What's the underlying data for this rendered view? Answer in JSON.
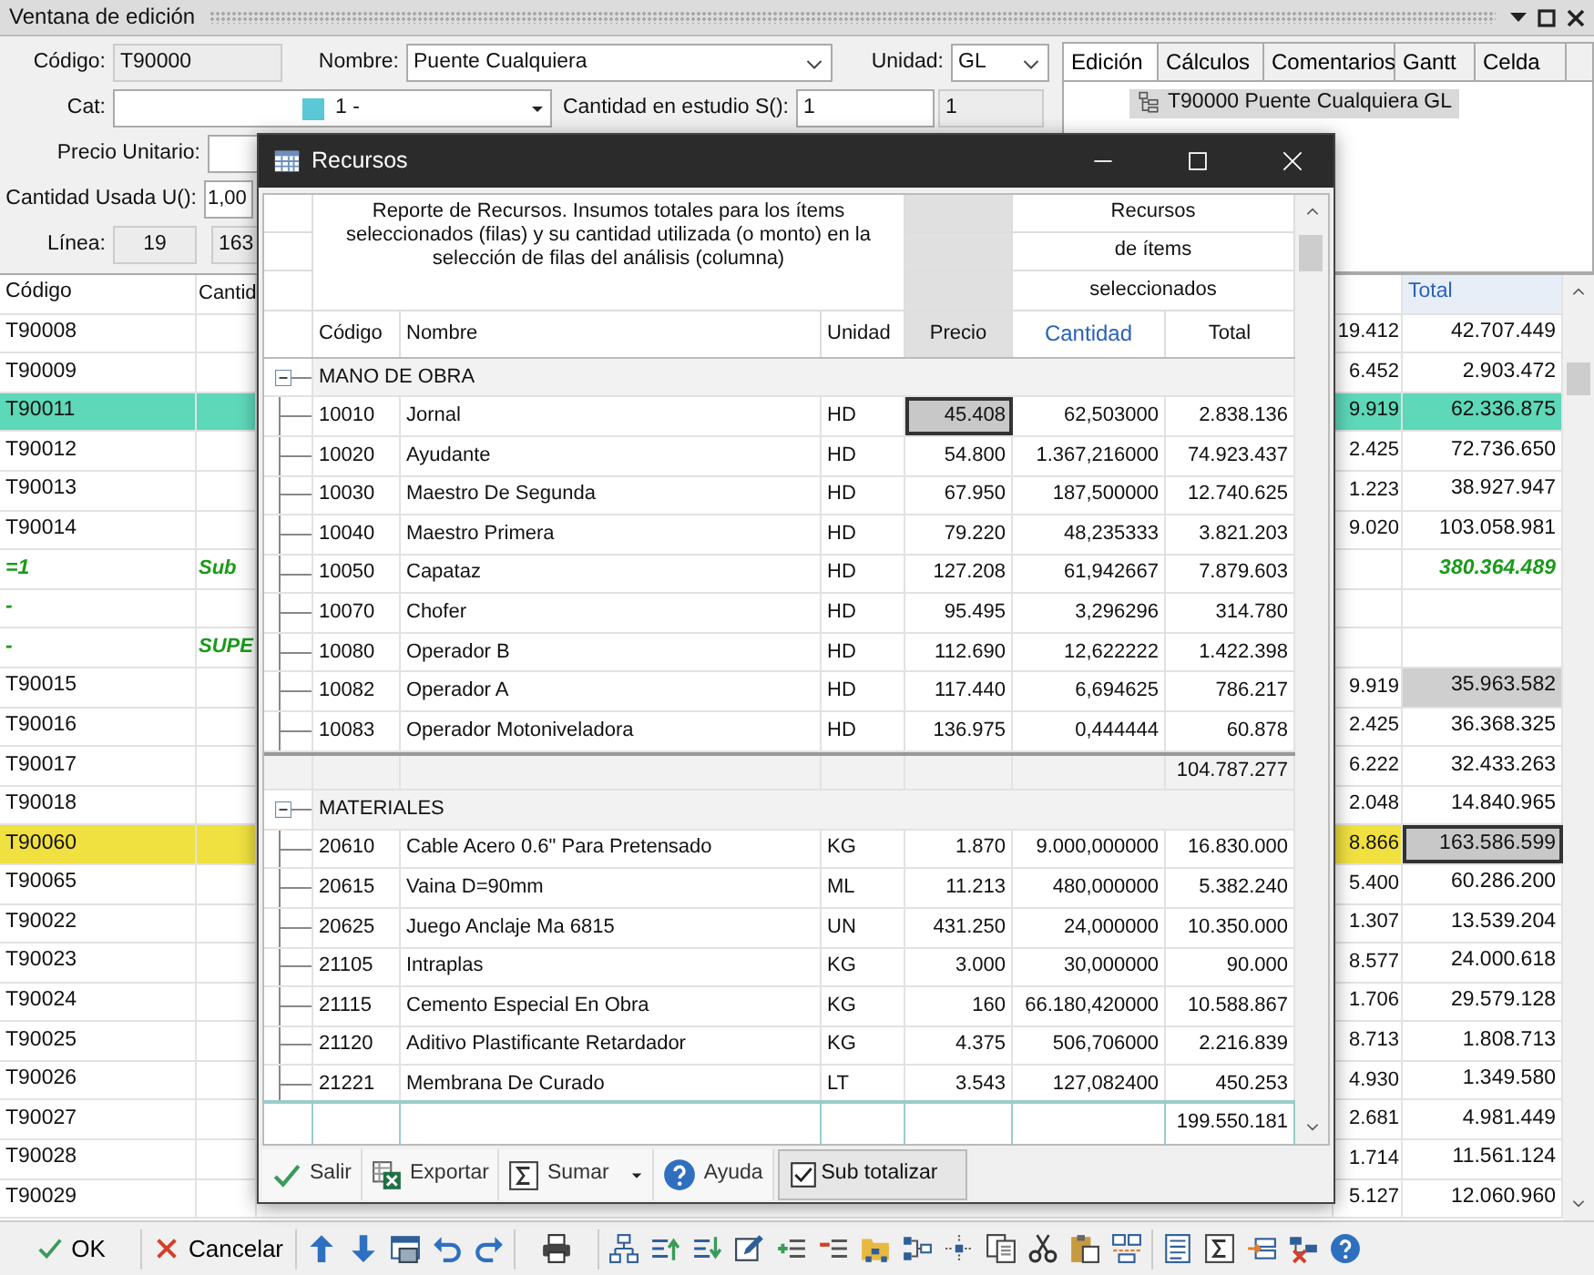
{
  "window": {
    "title": "Ventana de edición"
  },
  "form": {
    "codigo": {
      "label": "Código:",
      "value": "T90000"
    },
    "nombre": {
      "label": "Nombre:",
      "value": "Puente Cualquiera"
    },
    "unidad": {
      "label": "Unidad:",
      "value": "GL"
    },
    "cat": {
      "label": "Cat:",
      "value": "1 -",
      "color": "#5bc8d6"
    },
    "cantidad_estudio": {
      "label": "Cantidad en estudio S():",
      "value": "1",
      "value_2": "1"
    },
    "precio_unitario": {
      "label": "Precio Unitario:"
    },
    "cantidad_usada": {
      "label": "Cantidad Usada U():",
      "value": "1,00"
    },
    "linea": {
      "label": "Línea:",
      "value": "19",
      "value_2": "163"
    }
  },
  "side_panel": {
    "tabs": [
      {
        "label": "Edición",
        "selected": true
      },
      {
        "label": "Cálculos",
        "selected": false
      },
      {
        "label": "Comentarios",
        "selected": false
      },
      {
        "label": "Gantt",
        "selected": false
      },
      {
        "label": "Celda",
        "selected": false
      }
    ],
    "tree": [
      {
        "label": "T90000 Puente Cualquiera GL",
        "selected": true
      }
    ]
  },
  "table": {
    "columns": [
      "Código",
      "Cantid",
      "Total"
    ],
    "rows": [
      {
        "kind": "item",
        "code": "T90008",
        "column_2": "",
        "column_3": "19.412",
        "total": "42.707.449",
        "total_shaded": false,
        "total_focused": false
      },
      {
        "kind": "item",
        "code": "T90009",
        "column_2": "",
        "column_3": "6.452",
        "total": "2.903.472",
        "total_shaded": false,
        "total_focused": false
      },
      {
        "kind": "item",
        "code": "T90011",
        "column_2": "",
        "column_3": "9.919",
        "total": "62.336.875",
        "total_shaded": false,
        "total_focused": false,
        "color": "#5dd8b9"
      },
      {
        "kind": "item",
        "code": "T90012",
        "column_2": "",
        "column_3": "2.425",
        "total": "72.736.650",
        "total_shaded": false,
        "total_focused": false
      },
      {
        "kind": "item",
        "code": "T90013",
        "column_2": "",
        "column_3": "1.223",
        "total": "38.927.947",
        "total_shaded": false,
        "total_focused": false
      },
      {
        "kind": "item",
        "code": "T90014",
        "column_2": "",
        "column_3": "9.020",
        "total": "103.058.981",
        "total_shaded": false,
        "total_focused": false
      },
      {
        "kind": "subtotal",
        "code": "=1",
        "column_2": "Sub",
        "column_3": "",
        "total": "380.364.489",
        "total_shaded": false,
        "total_focused": false
      },
      {
        "kind": "subtotal",
        "code": "-",
        "column_2": "",
        "column_3": "",
        "total": "",
        "total_shaded": false,
        "total_focused": false
      },
      {
        "kind": "subtotal",
        "code": "-",
        "column_2": "SUPE",
        "column_3": "",
        "total": "",
        "total_shaded": false,
        "total_focused": false
      },
      {
        "kind": "item",
        "code": "T90015",
        "column_2": "",
        "column_3": "9.919",
        "total": "35.963.582",
        "total_shaded": true,
        "total_focused": false
      },
      {
        "kind": "item",
        "code": "T90016",
        "column_2": "",
        "column_3": "2.425",
        "total": "36.368.325",
        "total_shaded": false,
        "total_focused": false
      },
      {
        "kind": "item",
        "code": "T90017",
        "column_2": "",
        "column_3": "6.222",
        "total": "32.433.263",
        "total_shaded": false,
        "total_focused": false
      },
      {
        "kind": "item",
        "code": "T90018",
        "column_2": "",
        "column_3": "2.048",
        "total": "14.840.965",
        "total_shaded": false,
        "total_focused": false
      },
      {
        "kind": "item",
        "code": "T90060",
        "column_2": "",
        "column_3": "8.866",
        "total": "163.586.599",
        "total_shaded": false,
        "total_focused": true,
        "color": "#f0e040"
      },
      {
        "kind": "item",
        "code": "T90065",
        "column_2": "",
        "column_3": "5.400",
        "total": "60.286.200",
        "total_shaded": false,
        "total_focused": false
      },
      {
        "kind": "item",
        "code": "T90022",
        "column_2": "",
        "column_3": "1.307",
        "total": "13.539.204",
        "total_shaded": false,
        "total_focused": false
      },
      {
        "kind": "item",
        "code": "T90023",
        "column_2": "",
        "column_3": "8.577",
        "total": "24.000.618",
        "total_shaded": false,
        "total_focused": false
      },
      {
        "kind": "item",
        "code": "T90024",
        "column_2": "",
        "column_3": "1.706",
        "total": "29.579.128",
        "total_shaded": false,
        "total_focused": false
      },
      {
        "kind": "item",
        "code": "T90025",
        "column_2": "",
        "column_3": "8.713",
        "total": "1.808.713",
        "total_shaded": false,
        "total_focused": false
      },
      {
        "kind": "item",
        "code": "T90026",
        "column_2": "",
        "column_3": "4.930",
        "total": "1.349.580",
        "total_shaded": false,
        "total_focused": false
      },
      {
        "kind": "item",
        "code": "T90027",
        "column_2": "",
        "column_3": "2.681",
        "total": "4.981.449",
        "total_shaded": false,
        "total_focused": false
      },
      {
        "kind": "item",
        "code": "T90028",
        "column_2": "",
        "column_3": "1.714",
        "total": "11.561.124",
        "total_shaded": false,
        "total_focused": false
      },
      {
        "kind": "item",
        "code": "T90029",
        "column_2": "",
        "column_3": "5.127",
        "total": "12.060.960",
        "total_shaded": false,
        "total_focused": false
      }
    ]
  },
  "dialog": {
    "title": "Recursos",
    "description": "Reporte de Recursos. Insumos totales para los ítems seleccionados (filas) y su cantidad utilizada (o monto) en la selección de filas del análisis (columna)",
    "header_lines": [
      "Recursos",
      "de ítems",
      "seleccionados"
    ],
    "columns": [
      "Código",
      "Nombre",
      "Unidad",
      "Precio",
      "Cantidad",
      "Total"
    ],
    "groups": [
      {
        "name": "MANO DE OBRA",
        "expanded": true,
        "subtotal": "104.787.277",
        "items": [
          {
            "code": "10010",
            "name": "Jornal",
            "unit": "HD",
            "price": "45.408",
            "quantity": "62,503000",
            "total": "2.838.136",
            "focused": true
          },
          {
            "code": "10020",
            "name": "Ayudante",
            "unit": "HD",
            "price": "54.800",
            "quantity": "1.367,216000",
            "total": "74.923.437",
            "focused": false
          },
          {
            "code": "10030",
            "name": "Maestro De Segunda",
            "unit": "HD",
            "price": "67.950",
            "quantity": "187,500000",
            "total": "12.740.625",
            "focused": false
          },
          {
            "code": "10040",
            "name": "Maestro Primera",
            "unit": "HD",
            "price": "79.220",
            "quantity": "48,235333",
            "total": "3.821.203",
            "focused": false
          },
          {
            "code": "10050",
            "name": "Capataz",
            "unit": "HD",
            "price": "127.208",
            "quantity": "61,942667",
            "total": "7.879.603",
            "focused": false
          },
          {
            "code": "10070",
            "name": "Chofer",
            "unit": "HD",
            "price": "95.495",
            "quantity": "3,296296",
            "total": "314.780",
            "focused": false
          },
          {
            "code": "10080",
            "name": "Operador B",
            "unit": "HD",
            "price": "112.690",
            "quantity": "12,622222",
            "total": "1.422.398",
            "focused": false
          },
          {
            "code": "10082",
            "name": "Operador A",
            "unit": "HD",
            "price": "117.440",
            "quantity": "6,694625",
            "total": "786.217",
            "focused": false
          },
          {
            "code": "10083",
            "name": "Operador Motoniveladora",
            "unit": "HD",
            "price": "136.975",
            "quantity": "0,444444",
            "total": "60.878",
            "focused": false
          }
        ]
      },
      {
        "name": "MATERIALES",
        "expanded": true,
        "items": [
          {
            "code": "20610",
            "name": "Cable Acero 0.6\" Para Pretensado",
            "unit": "KG",
            "price": "1.870",
            "quantity": "9.000,000000",
            "total": "16.830.000",
            "focused": false
          },
          {
            "code": "20615",
            "name": "Vaina D=90mm",
            "unit": "ML",
            "price": "11.213",
            "quantity": "480,000000",
            "total": "5.382.240",
            "focused": false
          },
          {
            "code": "20625",
            "name": "Juego Anclaje Ma 6815",
            "unit": "UN",
            "price": "431.250",
            "quantity": "24,000000",
            "total": "10.350.000",
            "focused": false
          },
          {
            "code": "21105",
            "name": "Intraplas",
            "unit": "KG",
            "price": "3.000",
            "quantity": "30,000000",
            "total": "90.000",
            "focused": false
          },
          {
            "code": "21115",
            "name": "Cemento Especial En Obra",
            "unit": "KG",
            "price": "160",
            "quantity": "66.180,420000",
            "total": "10.588.867",
            "focused": false
          },
          {
            "code": "21120",
            "name": "Aditivo Plastificante Retardador",
            "unit": "KG",
            "price": "4.375",
            "quantity": "506,706000",
            "total": "2.216.839",
            "focused": false
          },
          {
            "code": "21221",
            "name": "Membrana De Curado",
            "unit": "LT",
            "price": "3.543",
            "quantity": "127,082400",
            "total": "450.253",
            "focused": false
          }
        ]
      }
    ],
    "footer_total": "199.550.181",
    "buttons": [
      {
        "label": "Salir",
        "kind": "exit"
      },
      {
        "label": "Exportar",
        "kind": "export"
      },
      {
        "label": "Sumar",
        "kind": "sum"
      },
      {
        "label": "Ayuda",
        "kind": "help"
      }
    ],
    "sub_totalizar": {
      "label": "Sub totalizar",
      "checked": true
    }
  },
  "toolbar": {
    "buttons": [
      {
        "label": "OK",
        "kind": "ok"
      },
      {
        "label": "Cancelar",
        "kind": "cancel"
      }
    ]
  }
}
